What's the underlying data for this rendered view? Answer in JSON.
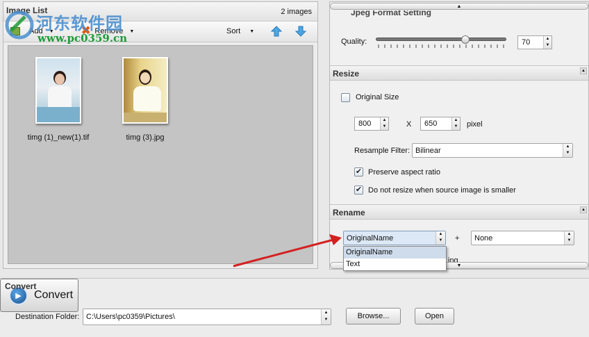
{
  "watermark": {
    "title": "河东软件园",
    "url": "www.pc0359.cn"
  },
  "image_list": {
    "title": "Image List",
    "count": "2 images",
    "toolbar": {
      "add": "Add",
      "remove": "Remove",
      "sort": "Sort"
    },
    "images": [
      {
        "name": "timg (1)_new(1).tif"
      },
      {
        "name": "timg (3).jpg"
      }
    ]
  },
  "jpeg": {
    "title": "Jpeg Format Setting",
    "quality_label": "Quality:",
    "quality_value": "70",
    "quality_level": 0.7
  },
  "resize": {
    "title": "Resize",
    "original_size_label": "Original Size",
    "original_size_checked": false,
    "width": "800",
    "x_label": "X",
    "height": "650",
    "unit": "pixel",
    "resample_label": "Resample Filter:",
    "resample_value": "Bilinear",
    "preserve_label": "Preserve aspect ratio",
    "preserve_checked": true,
    "noresize_label": "Do not resize when source image is smaller",
    "noresize_checked": true
  },
  "rename": {
    "title": "Rename",
    "left_value": "OriginalName",
    "plus": "+",
    "right_value": "None",
    "hidden_text": "ing",
    "options": [
      "OriginalName",
      "Text"
    ]
  },
  "convert": {
    "title": "Convert",
    "dest_label": "Destination Folder:",
    "dest_value": "C:\\Users\\pc0359\\Pictures\\",
    "browse": "Browse...",
    "open": "Open",
    "convert": "Convert"
  },
  "colors": {
    "arrow": "#d42020",
    "watermark_blue": "#4a8fd0",
    "watermark_green": "#1e9a38",
    "convert_icon": "#1b4f8c"
  }
}
